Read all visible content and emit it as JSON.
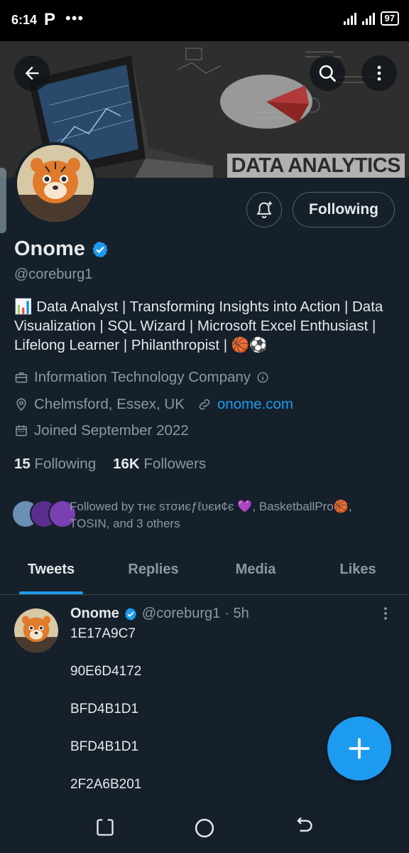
{
  "status_bar": {
    "time": "6:14",
    "app_icon": "P",
    "dots": "•••",
    "battery": "97"
  },
  "banner": {
    "text": "DATA ANALYTICS"
  },
  "header": {
    "back_icon": "arrow-left-icon",
    "search_icon": "search-icon",
    "more_icon": "more-vertical-icon"
  },
  "profile": {
    "name": "Onome",
    "handle": "@coreburg1",
    "bio": "📊 Data Analyst | Transforming Insights into Action | Data Visualization | SQL Wizard | Microsoft Excel Enthusiast | Lifelong Learner | Philanthropist | 🏀⚽",
    "category": "Information Technology Company",
    "location": "Chelmsford, Essex, UK",
    "website": "onome.com",
    "joined": "Joined September 2022",
    "following_count": "15",
    "following_label": "Following",
    "followers_count": "16K",
    "followers_label": "Followers",
    "follow_button": "Following",
    "followed_by": "Followed by ᴛнє ѕтσиєƒℓυєи¢є 💜, BasketballPro🏀, TOSIN, and 3 others"
  },
  "tabs": [
    "Tweets",
    "Replies",
    "Media",
    "Likes"
  ],
  "tweet": {
    "name": "Onome",
    "handle": "@coreburg1",
    "time": "· 5h",
    "lines": [
      "1E17A9C7",
      "90E6D4172",
      "BFD4B1D1",
      "BFD4B1D1",
      "2F2A6B201"
    ]
  },
  "colors": {
    "background": "#15202b",
    "accent": "#1d9bf0",
    "muted": "#8b98a5"
  }
}
